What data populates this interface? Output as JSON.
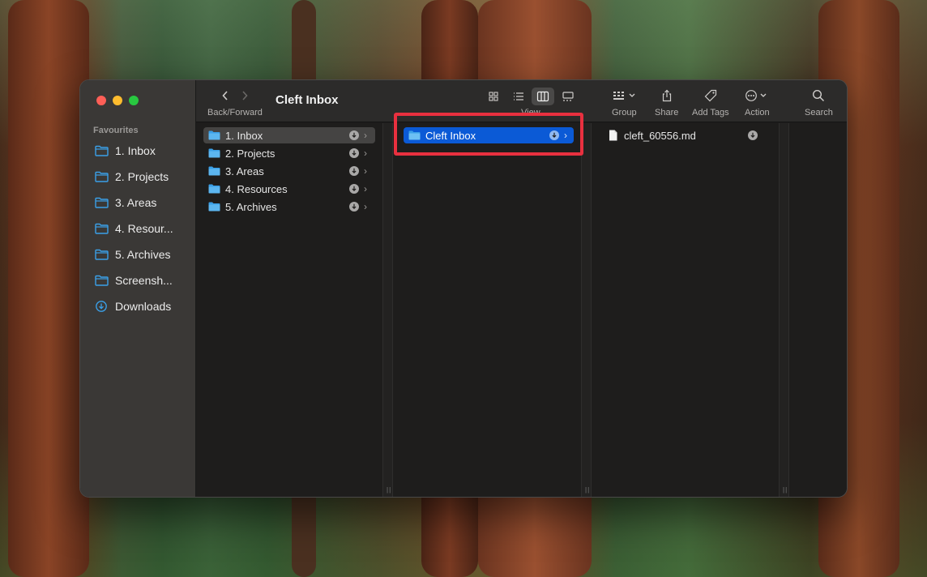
{
  "window": {
    "title": "Cleft Inbox"
  },
  "toolbar": {
    "back_forward_label": "Back/Forward",
    "view_label": "View",
    "group_label": "Group",
    "share_label": "Share",
    "add_tags_label": "Add Tags",
    "action_label": "Action",
    "search_label": "Search"
  },
  "sidebar": {
    "header": "Favourites",
    "items": [
      {
        "label": "1. Inbox",
        "icon": "folder-icon"
      },
      {
        "label": "2. Projects",
        "icon": "folder-icon"
      },
      {
        "label": "3. Areas",
        "icon": "folder-icon"
      },
      {
        "label": "4. Resour...",
        "icon": "folder-icon"
      },
      {
        "label": "5. Archives",
        "icon": "folder-icon"
      },
      {
        "label": "Screensh...",
        "icon": "folder-icon"
      },
      {
        "label": "Downloads",
        "icon": "download-circle-icon"
      }
    ]
  },
  "columns": {
    "first": [
      {
        "label": "1. Inbox",
        "selected": true
      },
      {
        "label": "2. Projects",
        "selected": false
      },
      {
        "label": "3. Areas",
        "selected": false
      },
      {
        "label": "4. Resources",
        "selected": false
      },
      {
        "label": "5. Archives",
        "selected": false
      }
    ],
    "second": [
      {
        "label": "Cleft Inbox",
        "selected": true
      }
    ],
    "third": [
      {
        "label": "cleft_60556.md"
      }
    ]
  },
  "colors": {
    "accent_blue": "#0b5ad6",
    "folder_blue": "#3aa0e8",
    "highlight_red": "#e8303f"
  }
}
